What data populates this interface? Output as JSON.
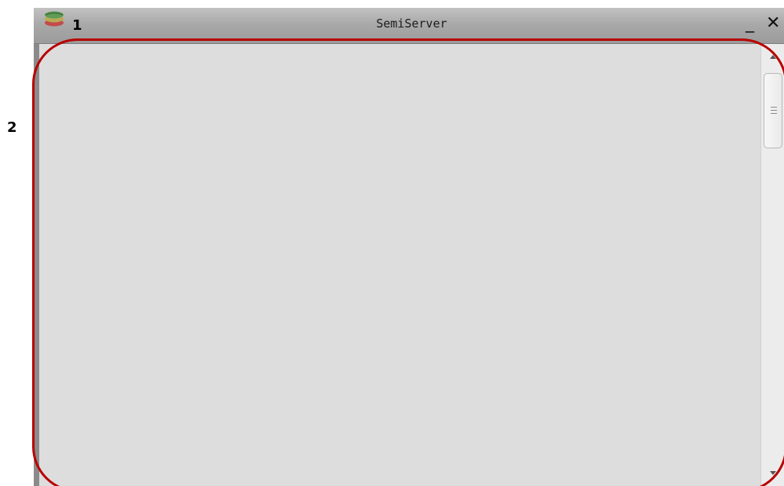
{
  "window": {
    "title": "SemiServer",
    "minimize_label": "_",
    "close_label": "✕",
    "app_icon": "semiserver-logo-icon"
  },
  "annotations": {
    "callout_1": "1",
    "callout_2": "2",
    "highlight_color": "#b80000"
  },
  "scrollbar": {
    "up_icon": "chevron-up-icon",
    "down_icon": "chevron-down-icon",
    "thumb_icon": "grip-lines-icon"
  }
}
